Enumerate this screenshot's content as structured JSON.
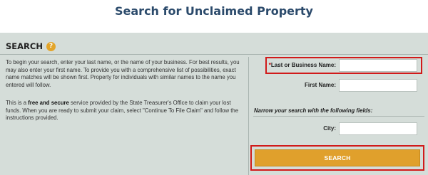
{
  "page": {
    "title": "Search for Unclaimed Property"
  },
  "search_panel": {
    "header": "SEARCH",
    "help_icon": "?",
    "description_1": "To begin your search, enter your last name, or the name of your business. For best results, you may also enter your first name. To provide you with a comprehensive list of possibilities, exact name matches will be shown first. Property for individuals with similar names to the name you entered will follow.",
    "description_2_prefix": "This is a ",
    "description_2_bold": "free and secure",
    "description_2_suffix": " service provided by the State Treasurer's Office to claim your lost funds. When you are ready to submit your claim, select \"Continue To File Claim\" and follow the instructions provided."
  },
  "form": {
    "required_marker": "*",
    "last_name_label": "Last or Business Name:",
    "last_name_value": "",
    "first_name_label": "First Name:",
    "first_name_value": "",
    "narrow_hint": "Narrow your search with the following fields:",
    "city_label": "City:",
    "city_value": "",
    "search_button": "SEARCH"
  },
  "colors": {
    "title": "#2b4a6b",
    "panel_background": "#d5ddd9",
    "accent": "#e0a02c",
    "highlight": "#d11a1a"
  }
}
